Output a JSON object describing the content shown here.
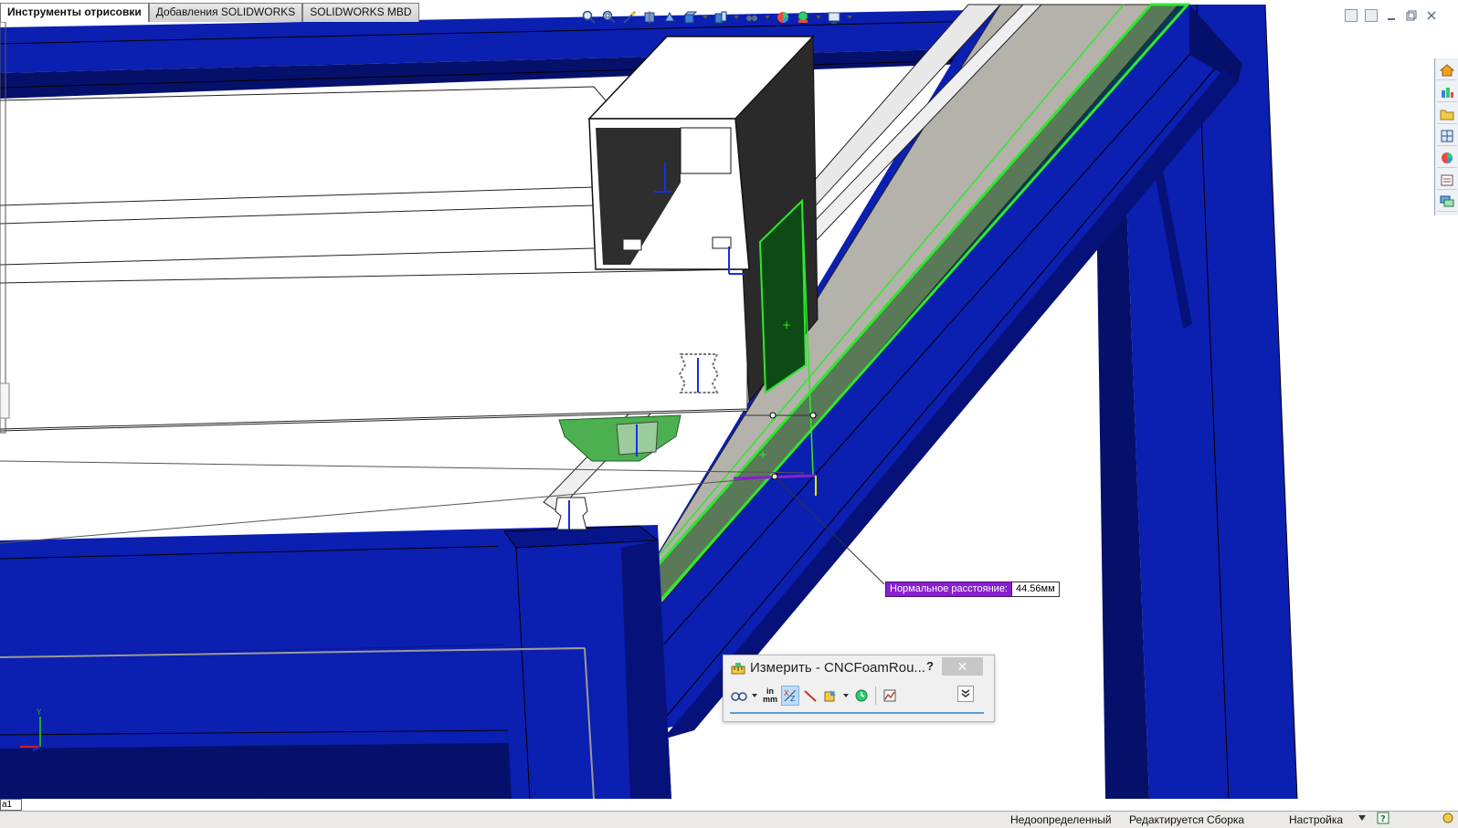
{
  "tabs": [
    "Инструменты отрисовки",
    "Добавления SOLIDWORKS",
    "SOLIDWORKS MBD"
  ],
  "hud_icons": [
    "zoom-to-fit-icon",
    "zoom-to-area-icon",
    "previous-view-icon",
    "section-view-icon",
    "dynamic-annotation-icon",
    "view-orientation-icon",
    "display-style-icon",
    "hide-show-items-icon",
    "edit-appearance-icon",
    "apply-scene-icon",
    "view-settings-icon"
  ],
  "window_controls": [
    "tile-horizontal-icon",
    "tile-vertical-icon",
    "minimize-icon",
    "restore-icon",
    "close-icon"
  ],
  "task_pane": [
    "home-icon",
    "design-library-icon",
    "file-explorer-icon",
    "view-palette-icon",
    "appearances-icon",
    "custom-properties-icon",
    "forum-icon"
  ],
  "measurement": {
    "label": "Нормальное расстояние:",
    "value": "44.56мм"
  },
  "measure_dialog": {
    "title": "Измерить - CNCFoamRou...",
    "help": "?",
    "close": "✕",
    "units_top": "in",
    "units_bottom": "mm",
    "tools": [
      "arc-circle-measurements-icon",
      "units-precision-icon",
      "show-xyz-measurements-icon",
      "point-to-point-icon",
      "projected-on-icon",
      "measurement-history-icon",
      "create-sensor-icon"
    ]
  },
  "sheet_tab": "а1",
  "status": {
    "definition": "Недоопределенный",
    "mode": "Редактируется Сборка",
    "settings": "Настройка"
  },
  "colors": {
    "frame_blue": "#0b1fb0",
    "frame_dark": "#05106a",
    "selection_green": "#2ee82e",
    "measure_purple": "#8a1fd1"
  }
}
